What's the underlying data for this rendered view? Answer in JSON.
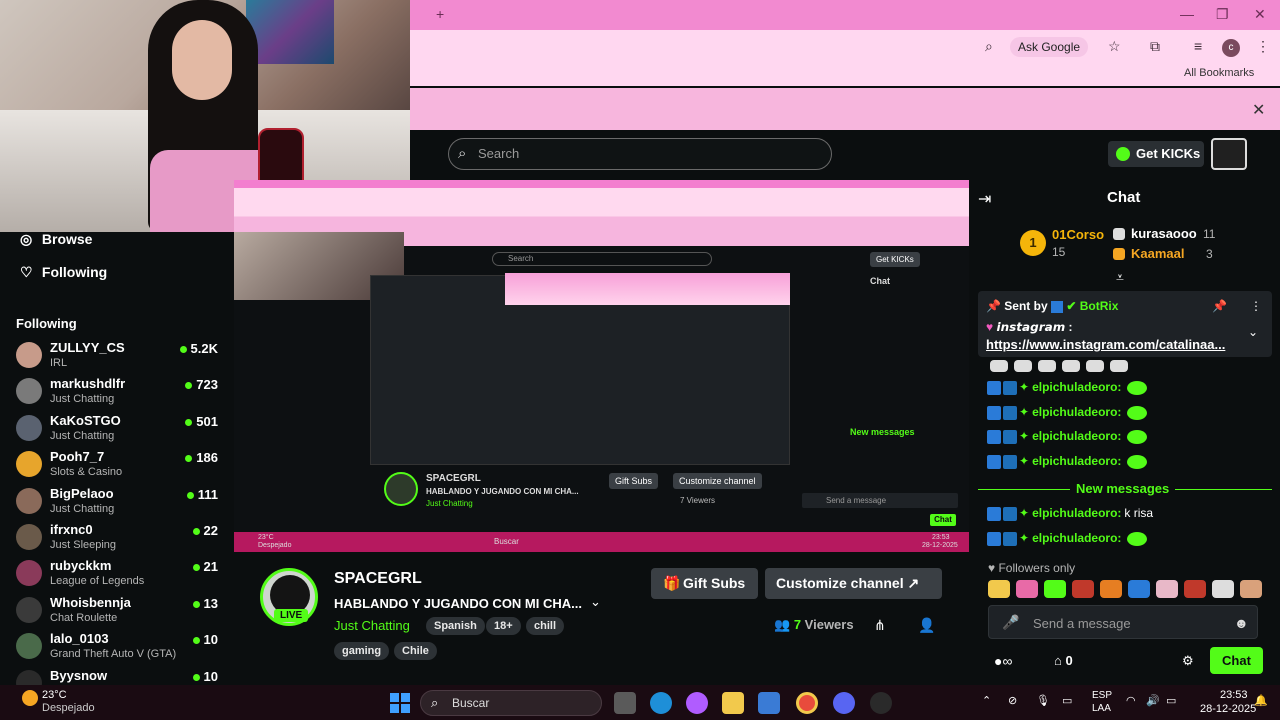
{
  "browser": {
    "new_tab": "+",
    "window_min": "—",
    "window_max": "❐",
    "window_close": "✕",
    "ask_google": "Ask Google",
    "all_bookmarks": "All Bookmarks",
    "profile_initial": "c",
    "banner_close": "✕"
  },
  "header": {
    "search_placeholder": "Search",
    "get_kicks": "Get KICKs"
  },
  "sidebar": {
    "browse": "Browse",
    "following_nav": "Following",
    "following_heading": "Following",
    "items": [
      {
        "name": "ZULLYY_CS",
        "category": "IRL",
        "viewers": "5.2K"
      },
      {
        "name": "markushdlfr",
        "category": "Just Chatting",
        "viewers": "723"
      },
      {
        "name": "KaKoSTGO",
        "category": "Just Chatting",
        "viewers": "501"
      },
      {
        "name": "Pooh7_7",
        "category": "Slots & Casino",
        "viewers": "186"
      },
      {
        "name": "BigPelaoo",
        "category": "Just Chatting",
        "viewers": "111"
      },
      {
        "name": "ifrxnc0",
        "category": "Just Sleeping",
        "viewers": "22"
      },
      {
        "name": "rubyckkm",
        "category": "League of Legends",
        "viewers": "21"
      },
      {
        "name": "Whoisbennja",
        "category": "Chat Roulette",
        "viewers": "13"
      },
      {
        "name": "lalo_0103",
        "category": "Grand Theft Auto V (GTA)",
        "viewers": "10"
      },
      {
        "name": "Byysnow",
        "category": "",
        "viewers": "10"
      }
    ]
  },
  "nested": {
    "search": "Search",
    "get_kicks": "Get KICKs",
    "chat": "Chat",
    "channel": "SPACEGRL",
    "title": "HABLANDO Y JUGANDO CON MI CHA...",
    "category": "Just Chatting",
    "gift_subs": "Gift Subs",
    "customize": "Customize channel",
    "viewers": "7 Viewers",
    "new_messages": "New messages",
    "send": "Send a message",
    "chat_btn": "Chat",
    "weather": "23°C",
    "weather_desc": "Despejado",
    "tb_search": "Buscar",
    "time": "23:53",
    "date": "28-12-2025"
  },
  "stream": {
    "channel_name": "SPACEGRL",
    "live": "LIVE",
    "title": "HABLANDO Y JUGANDO CON MI CHA...",
    "category": "Just Chatting",
    "tags": [
      "Spanish",
      "18+",
      "chill",
      "gaming",
      "Chile"
    ],
    "gift_subs": "Gift Subs",
    "customize_channel": "Customize channel",
    "viewers_count": "7",
    "viewers_label": "Viewers"
  },
  "chat": {
    "title": "Chat",
    "leaderboard": [
      {
        "rank": "1",
        "name": "01Corso",
        "count": "15",
        "color": "#f5b50a"
      },
      {
        "rank": "2",
        "name": "kurasaooo",
        "count": "11",
        "color": "#ffffff"
      },
      {
        "rank": "3",
        "name": "Kaamaal",
        "count": "3",
        "color": "#f5a623"
      }
    ],
    "pinned": {
      "sent_by": "Sent by",
      "bot": "BotRix",
      "label": "𝙞𝙣𝙨𝙩𝙖𝙜𝙧𝙖𝙢 :",
      "link": "https://www.instagram.com/catalinaa..."
    },
    "messages": [
      {
        "user": "elpichuladeoro:",
        "text": ""
      },
      {
        "user": "elpichuladeoro:",
        "text": ""
      },
      {
        "user": "elpichuladeoro:",
        "text": ""
      },
      {
        "user": "elpichuladeoro:",
        "text": ""
      }
    ],
    "new_messages": "New messages",
    "after": [
      {
        "user": "elpichuladeoro:",
        "text": "k risa"
      },
      {
        "user": "elpichuladeoro:",
        "text": ""
      }
    ],
    "followers_only": "Followers only",
    "input_placeholder": "Send a message",
    "kicks": "0",
    "chat_button": "Chat"
  },
  "taskbar": {
    "temperature": "23°C",
    "weather": "Despejado",
    "search": "Buscar",
    "lang1": "ESP",
    "lang2": "LAA",
    "time": "23:53",
    "date": "28-12-2025"
  },
  "colors": {
    "accent": "#53fc18",
    "chrome_pink": "#f28ad0",
    "background": "#0b0e0f"
  }
}
